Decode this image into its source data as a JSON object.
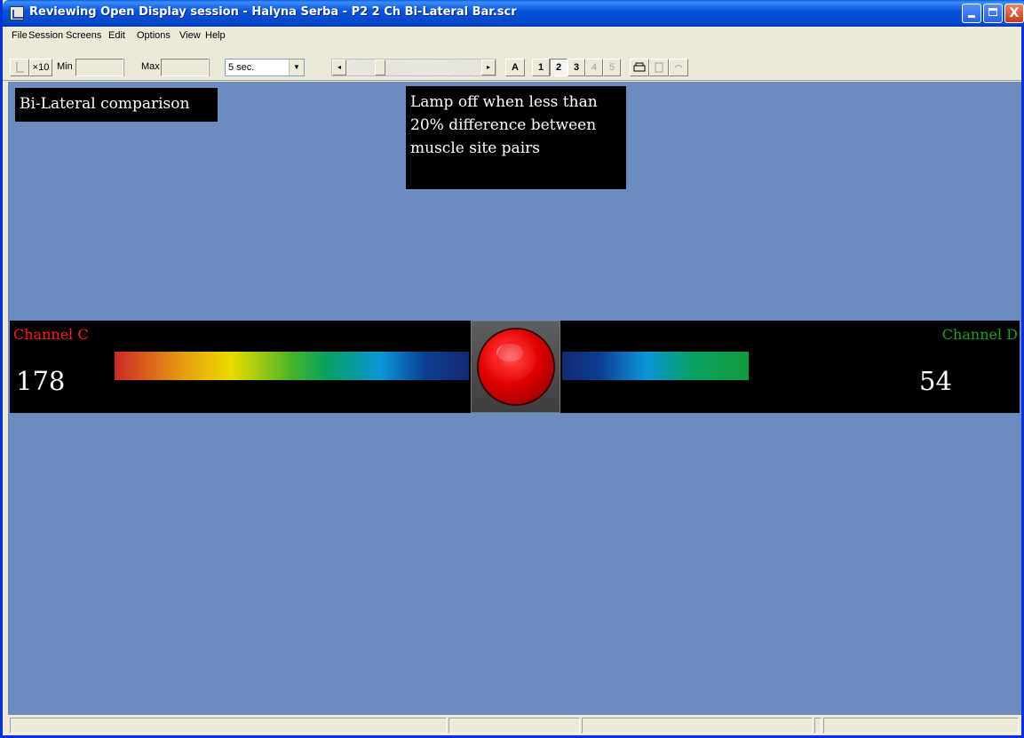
{
  "window": {
    "title": "Reviewing Open Display session - Halyna Serba - P2 2 Ch Bi-Lateral Bar.scr",
    "minimize": "_",
    "maximize": "□",
    "close": "X"
  },
  "menu": [
    "File",
    "Session",
    "Screens",
    "Edit",
    "Options",
    "View",
    "Help"
  ],
  "toolbar": {
    "cursor_btn": "",
    "x10_btn": "×10",
    "min_label": "Min",
    "max_label": "Max",
    "min_value": "",
    "max_value": "",
    "time_select": "5 sec.",
    "scroll_left": "◂",
    "scroll_right": "▸",
    "auto_btn": "A",
    "screen_buttons": [
      {
        "label": "1",
        "state": "normal"
      },
      {
        "label": "2",
        "state": "pressed"
      },
      {
        "label": "3",
        "state": "normal"
      },
      {
        "label": "4",
        "state": "disabled"
      },
      {
        "label": "5",
        "state": "disabled"
      }
    ],
    "print_icon": "printer-icon",
    "page_icon": "page-icon",
    "undo_icon": "undo-icon"
  },
  "notes": {
    "title": "Bi-Lateral comparison",
    "instruction": "Lamp off when less than 20% difference between muscle site pairs"
  },
  "channels": {
    "left": {
      "name": "Channel C",
      "value": "178",
      "color": "#ff1a1a"
    },
    "right": {
      "name": "Channel D",
      "value": "54",
      "color": "#19a019"
    }
  },
  "lamp": {
    "state": "on",
    "color": "#e00000"
  },
  "colors": {
    "background": "#6c8cc0",
    "panel": "#000000",
    "titlebar": "#0855dd"
  }
}
